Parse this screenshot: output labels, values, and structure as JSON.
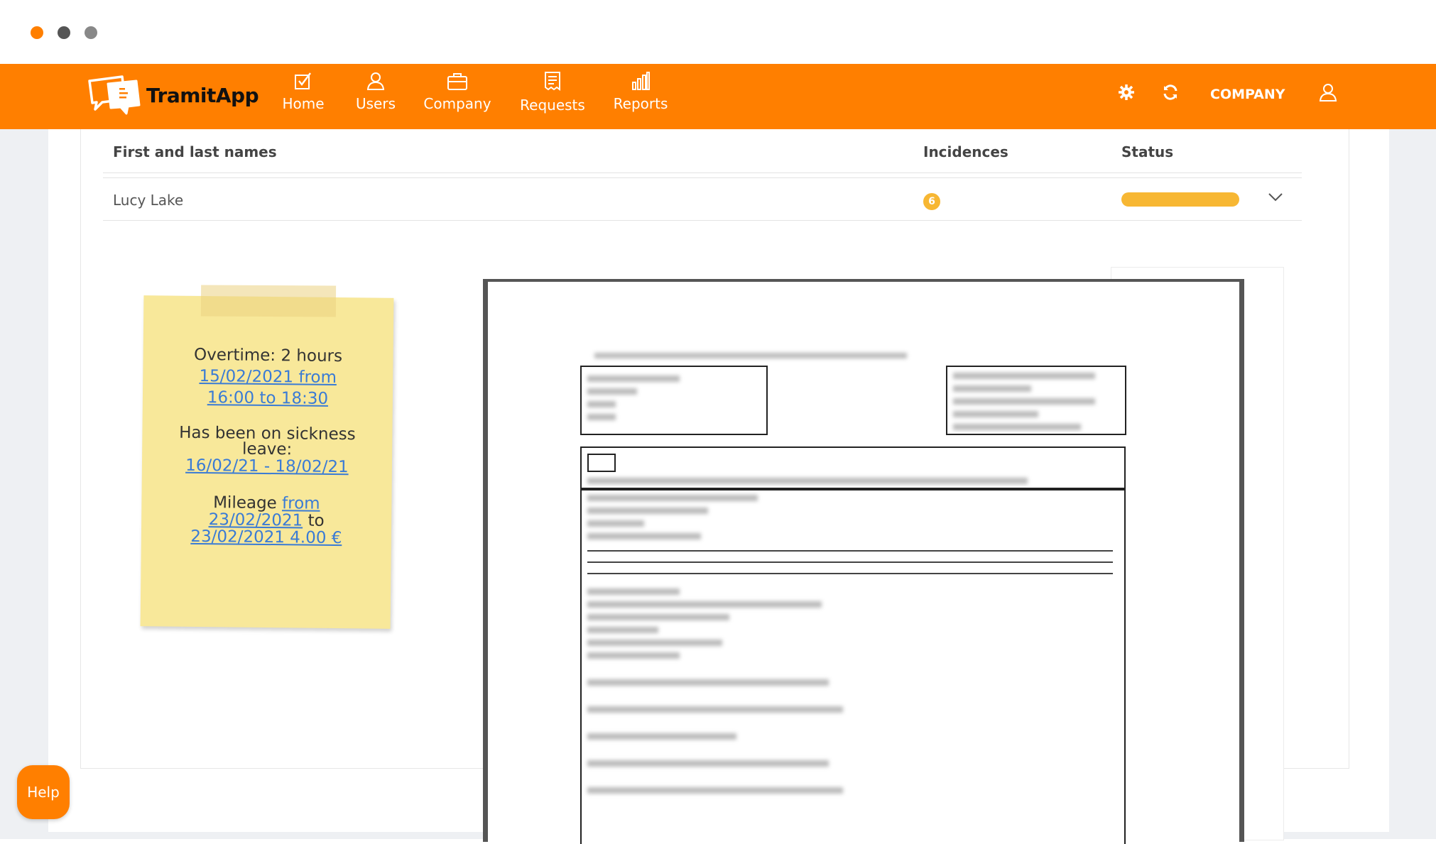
{
  "window": {
    "dot_colors": [
      "#ff7f00",
      "#555555",
      "#888888"
    ]
  },
  "brand": {
    "name_part1": "Tramit",
    "name_part2": "App",
    "accent": "#ff7f00"
  },
  "nav": {
    "items": [
      {
        "label": "Home",
        "icon": "checkbox-icon"
      },
      {
        "label": "Users",
        "icon": "user-icon"
      },
      {
        "label": "Company",
        "icon": "briefcase-icon"
      },
      {
        "label": "Requests",
        "icon": "receipt-icon"
      },
      {
        "label": "Reports",
        "icon": "bar-chart-icon"
      }
    ],
    "company_label": "COMPANY"
  },
  "table": {
    "headers": {
      "name": "First and last names",
      "incidences": "Incidences",
      "status": "Status"
    },
    "rows": [
      {
        "name": "Lucy Lake",
        "incidences": "6",
        "status_color": "#f7b733"
      }
    ]
  },
  "note": {
    "overtime": "Overtime: 2 hours",
    "overtime_date": "15/02/2021 from",
    "overtime_time": "16:00 to 18:30",
    "sickness_line1": "Has been on sickness",
    "sickness_line2": "leave:",
    "sickness_dates": "16/02/21 - 18/02/21",
    "mileage_label": "Mileage",
    "mileage_from": "from",
    "mileage_from_date": "23/02/2021",
    "mileage_to": "to",
    "mileage_to_value": "23/02/2021 4.00 €",
    "paper_color": "#f8e89a"
  },
  "help": {
    "label": "Help"
  }
}
